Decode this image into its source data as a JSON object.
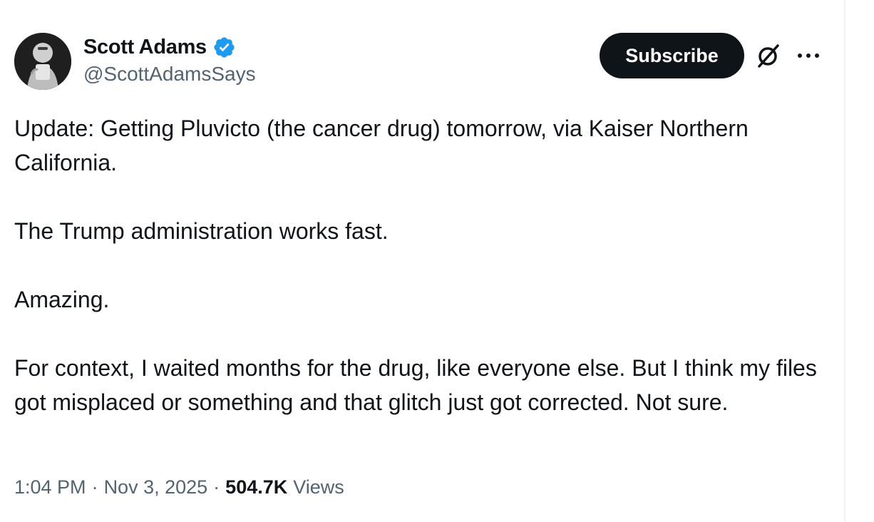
{
  "author": {
    "name": "Scott Adams",
    "handle": "@ScottAdamsSays",
    "verified": true,
    "avatar_icon": "avatar-photo"
  },
  "actions": {
    "subscribe_label": "Subscribe",
    "grok_icon": "grok-icon",
    "more_icon": "more-icon"
  },
  "tweet": {
    "paragraphs": [
      "Update: Getting Pluvicto (the cancer drug) tomorrow, via Kaiser Northern California.",
      "The Trump administration works fast.",
      "Amazing.",
      "For context, I waited months for the drug, like everyone else. But I think my files got misplaced or something and that glitch just got corrected. Not sure."
    ]
  },
  "meta": {
    "time": "1:04 PM",
    "separator": "·",
    "date": "Nov 3, 2025",
    "views_count": "504.7K",
    "views_label": "Views"
  },
  "colors": {
    "text_primary": "#0f1419",
    "text_secondary": "#536471",
    "verified_blue": "#1d9bf0",
    "button_bg": "#0f1419"
  }
}
